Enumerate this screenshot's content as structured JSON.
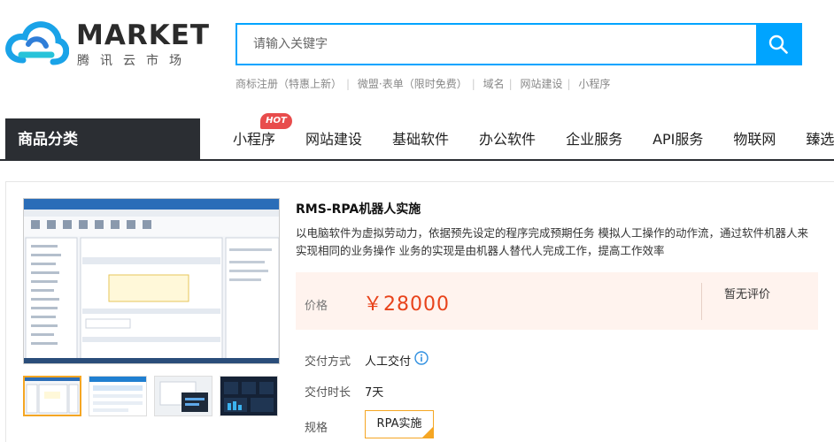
{
  "logo": {
    "name": "MARKET",
    "sub": "腾讯云市场"
  },
  "search": {
    "placeholder": "请输入关键字"
  },
  "hotlinks": [
    "商标注册（特惠上新）",
    "微盟·表单（限时免费）",
    "域名",
    "网站建设",
    "小程序"
  ],
  "nav": {
    "category_title": "商品分类",
    "items": [
      "小程序",
      "网站建设",
      "基础软件",
      "办公软件",
      "企业服务",
      "API服务",
      "物联网",
      "臻选"
    ],
    "hot_badge": "HOT"
  },
  "product": {
    "title": "RMS-RPA机器人实施",
    "description": "以电脑软件为虚拟劳动力，依据预先设定的程序完成预期任务 模拟人工操作的动作流，通过软件机器人来实现相同的业务操作 业务的实现是由机器人替代人完成工作，提高工作效率",
    "price_label": "价格",
    "price": "￥28000",
    "rating": "暂无评价",
    "delivery_label": "交付方式",
    "delivery_value": "人工交付",
    "duration_label": "交付时长",
    "duration_value": "7天",
    "spec_label": "规格",
    "spec_value": "RPA实施"
  },
  "colors": {
    "accent": "#00a4ff",
    "price": "#e8431b",
    "nav_dark": "#2b2e33",
    "hot": "#e84c4c",
    "spec_border": "#f5a623"
  }
}
